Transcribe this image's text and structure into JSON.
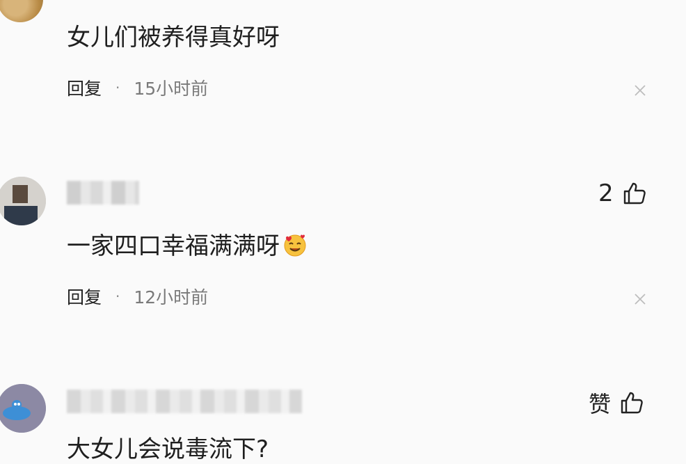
{
  "comments": [
    {
      "text": "女儿们被养得真好呀",
      "reply_label": "回复",
      "separator": "·",
      "time": "15小时前"
    },
    {
      "like_count": "2",
      "text": "一家四口幸福满满呀",
      "emoji": "smiling-face-with-hearts",
      "reply_label": "回复",
      "separator": "·",
      "time": "12小时前"
    },
    {
      "like_label": "赞",
      "text_partial": "大女儿会说毒流下?"
    }
  ],
  "icons": {
    "like": "thumbs-up-icon",
    "close": "close-icon"
  }
}
